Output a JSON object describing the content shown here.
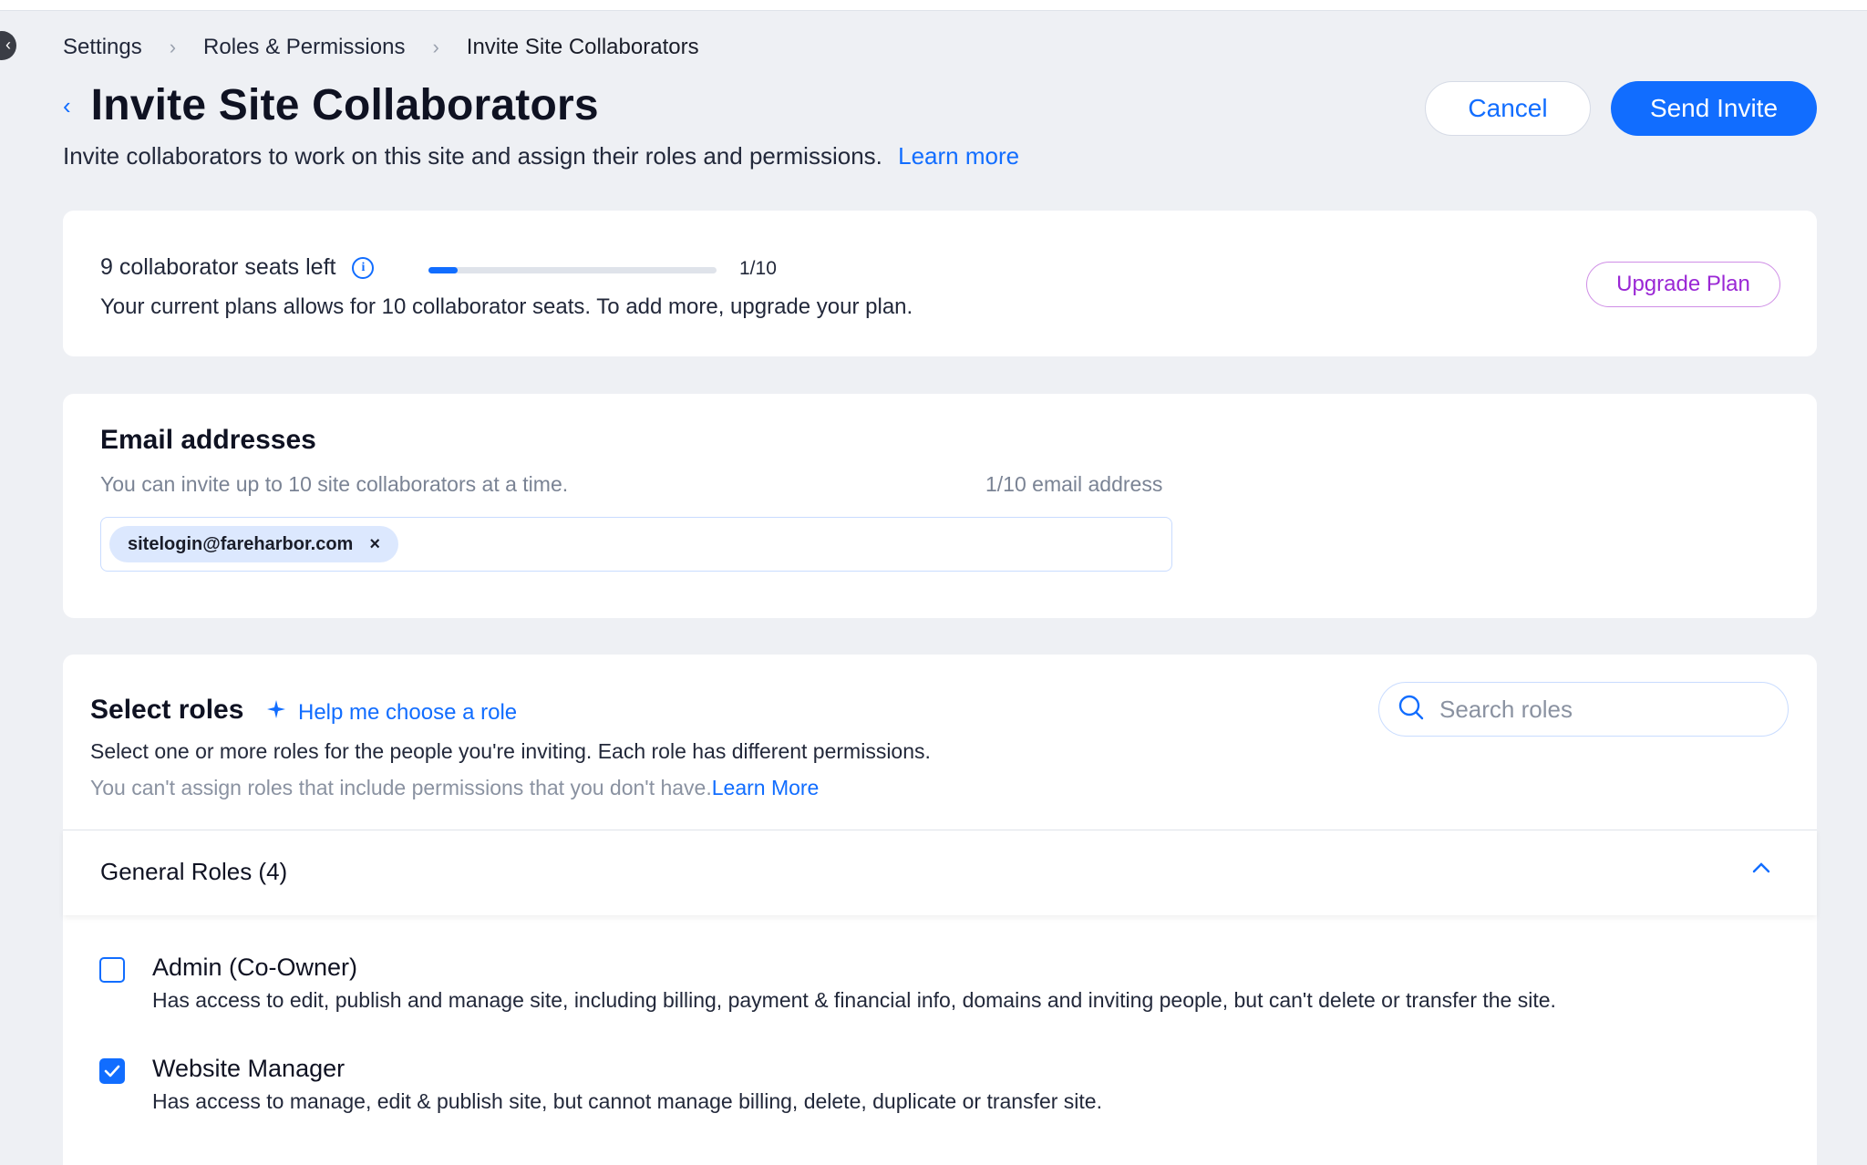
{
  "breadcrumb": {
    "items": [
      "Settings",
      "Roles & Permissions",
      "Invite Site Collaborators"
    ]
  },
  "header": {
    "title": "Invite Site Collaborators",
    "subtitle": "Invite collaborators to work on this site and assign their roles and permissions.",
    "learn_more": "Learn more",
    "cancel_label": "Cancel",
    "send_label": "Send Invite"
  },
  "seats": {
    "title": "9 collaborator seats left",
    "progress_label": "1/10",
    "progress_fraction": 0.1,
    "description": "Your current plans allows for 10 collaborator seats. To add more, upgrade your plan.",
    "upgrade_label": "Upgrade Plan"
  },
  "email": {
    "heading": "Email addresses",
    "help": "You can invite up to 10 site collaborators at a time.",
    "count": "1/10 email address",
    "chips": [
      "sitelogin@fareharbor.com"
    ],
    "chip_remove": "×"
  },
  "roles": {
    "heading": "Select roles",
    "help_choose": "Help me choose a role",
    "description": "Select one or more roles for the people you're inviting. Each role has different permissions.",
    "note": "You can't assign roles that include permissions that you don't have.",
    "note_link": "Learn More",
    "search_placeholder": "Search roles",
    "group_title": "General Roles (4)",
    "items": [
      {
        "name": "Admin (Co-Owner)",
        "description": "Has access to edit, publish and manage site, including billing, payment & financial info, domains and inviting people, but can't delete or transfer the site.",
        "checked": false
      },
      {
        "name": "Website Manager",
        "description": "Has access to manage, edit & publish site, but cannot manage billing, delete, duplicate or transfer site.",
        "checked": true
      }
    ]
  },
  "colors": {
    "accent": "#116dff",
    "upgrade": "#9a27d5",
    "background": "#eef0f4"
  }
}
